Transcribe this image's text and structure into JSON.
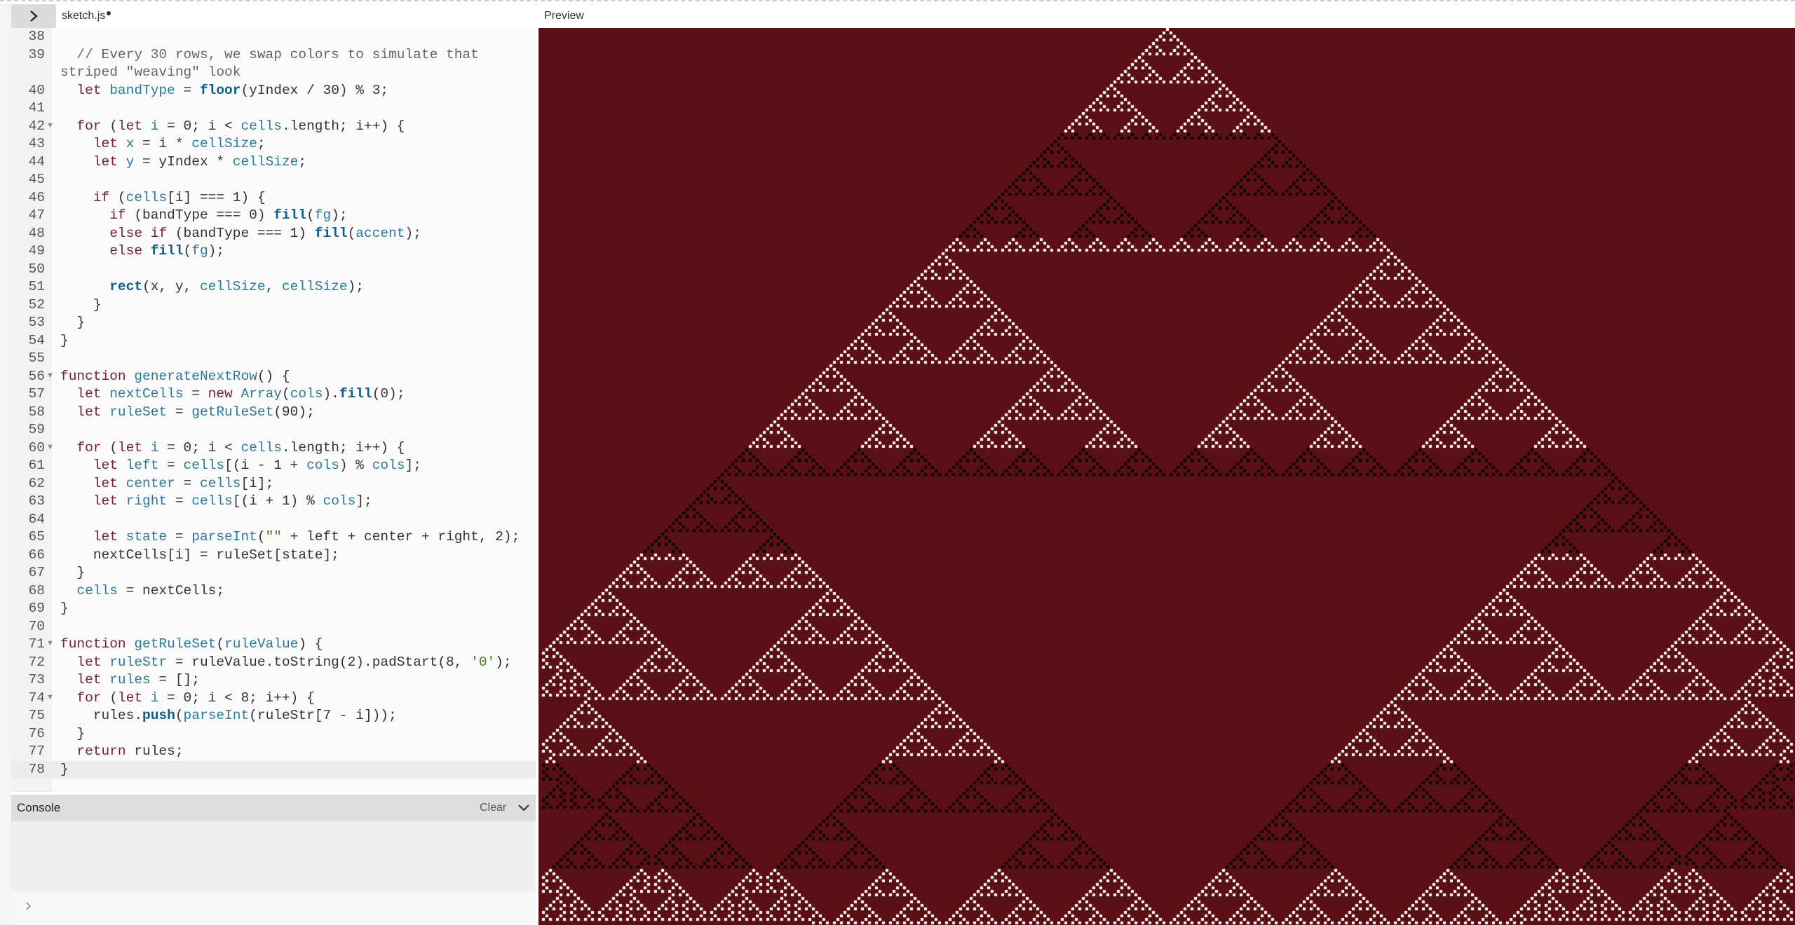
{
  "editor": {
    "filename": "sketch.js",
    "unsaved_indicator": "●",
    "lines": [
      {
        "n": "38",
        "html": ""
      },
      {
        "n": "39",
        "wrap": true,
        "html": "  <span class='cm'>// Every 30 rows, we swap colors to simulate that striped \"weaving\" look</span>"
      },
      {
        "n": "40",
        "html": "  <span class='kw'>let</span> <span class='vr'>bandType</span> = <span class='fn'>floor</span>(yIndex / <span class='nm'>30</span>) % <span class='nm'>3</span>;"
      },
      {
        "n": "41",
        "html": ""
      },
      {
        "n": "42",
        "fold": true,
        "html": "  <span class='kw'>for</span> (<span class='kw'>let</span> <span class='vr'>i</span> = 0; i &lt; <span class='vr'>cells</span>.length; i++) {"
      },
      {
        "n": "43",
        "html": "    <span class='kw'>let</span> <span class='vr'>x</span> = i * <span class='vr'>cellSize</span>;"
      },
      {
        "n": "44",
        "html": "    <span class='kw'>let</span> <span class='vr'>y</span> = yIndex * <span class='vr'>cellSize</span>;"
      },
      {
        "n": "45",
        "html": ""
      },
      {
        "n": "46",
        "html": "    <span class='kw'>if</span> (<span class='vr'>cells</span>[i] === 1) {"
      },
      {
        "n": "47",
        "html": "      <span class='kw'>if</span> (bandType === 0) <span class='fn'>fill</span>(<span class='vr'>fg</span>);"
      },
      {
        "n": "48",
        "html": "      <span class='kw'>else if</span> (bandType === 1) <span class='fn'>fill</span>(<span class='vr'>accent</span>);"
      },
      {
        "n": "49",
        "html": "      <span class='kw'>else</span> <span class='fn'>fill</span>(<span class='vr'>fg</span>);"
      },
      {
        "n": "50",
        "html": ""
      },
      {
        "n": "51",
        "html": "      <span class='fn'>rect</span>(x, y, <span class='vr'>cellSize</span>, <span class='vr'>cellSize</span>);"
      },
      {
        "n": "52",
        "html": "    }"
      },
      {
        "n": "53",
        "html": "  }"
      },
      {
        "n": "54",
        "html": "}"
      },
      {
        "n": "55",
        "html": ""
      },
      {
        "n": "56",
        "fold": true,
        "html": "<span class='kw'>function</span> <span class='vr'>generateNextRow</span>() {"
      },
      {
        "n": "57",
        "html": "  <span class='kw'>let</span> <span class='vr'>nextCells</span> = <span class='kw'>new</span> <span class='vr'>Array</span>(<span class='vr'>cols</span>).<span class='fn'>fill</span>(0);"
      },
      {
        "n": "58",
        "html": "  <span class='kw'>let</span> <span class='vr'>ruleSet</span> = <span class='vr'>getRuleSet</span>(90);"
      },
      {
        "n": "59",
        "html": ""
      },
      {
        "n": "60",
        "fold": true,
        "html": "  <span class='kw'>for</span> (<span class='kw'>let</span> <span class='vr'>i</span> = 0; i &lt; <span class='vr'>cells</span>.length; i++) {"
      },
      {
        "n": "61",
        "html": "    <span class='kw'>let</span> <span class='vr'>left</span> = <span class='vr'>cells</span>[(i - 1 + <span class='vr'>cols</span>) % <span class='vr'>cols</span>];"
      },
      {
        "n": "62",
        "html": "    <span class='kw'>let</span> <span class='vr'>center</span> = <span class='vr'>cells</span>[i];"
      },
      {
        "n": "63",
        "html": "    <span class='kw'>let</span> <span class='vr'>right</span> = <span class='vr'>cells</span>[(i + 1) % <span class='vr'>cols</span>];"
      },
      {
        "n": "64",
        "html": ""
      },
      {
        "n": "65",
        "html": "    <span class='kw'>let</span> <span class='vr'>state</span> = <span class='vr'>parseInt</span>(<span class='st'>\"\"</span> + left + center + right, 2);"
      },
      {
        "n": "66",
        "html": "    nextCells[i] = ruleSet[state];"
      },
      {
        "n": "67",
        "html": "  }"
      },
      {
        "n": "68",
        "html": "  <span class='vr'>cells</span> = nextCells;"
      },
      {
        "n": "69",
        "html": "}"
      },
      {
        "n": "70",
        "html": ""
      },
      {
        "n": "71",
        "fold": true,
        "html": "<span class='kw'>function</span> <span class='vr'>getRuleSet</span>(<span class='vr'>ruleValue</span>) {"
      },
      {
        "n": "72",
        "html": "  <span class='kw'>let</span> <span class='vr'>ruleStr</span> = ruleValue.toString(2).padStart(8, <span class='st'>'0'</span>);"
      },
      {
        "n": "73",
        "html": "  <span class='kw'>let</span> <span class='vr'>rules</span> = [];"
      },
      {
        "n": "74",
        "fold": true,
        "html": "  <span class='kw'>for</span> (<span class='kw'>let</span> <span class='vr'>i</span> = 0; i &lt; 8; i++) {"
      },
      {
        "n": "75",
        "html": "    rules.<span class='fn'>push</span>(<span class='vr'>parseInt</span>(ruleStr[7 - i]));"
      },
      {
        "n": "76",
        "html": "  }"
      },
      {
        "n": "77",
        "html": "  <span class='kw'>return</span> rules;"
      },
      {
        "n": "78",
        "active": true,
        "html": "}"
      }
    ]
  },
  "preview": {
    "label": "Preview",
    "background": "#5a0f15",
    "fg": "#ffffff",
    "accent": "#000000",
    "rule": 90,
    "band_rows": 30
  },
  "console": {
    "title": "Console",
    "clear_label": "Clear"
  },
  "icons": {
    "toggle": "chevron-right-icon",
    "console_collapse": "chevron-down-icon",
    "console_prompt": "chevron-right-icon"
  }
}
